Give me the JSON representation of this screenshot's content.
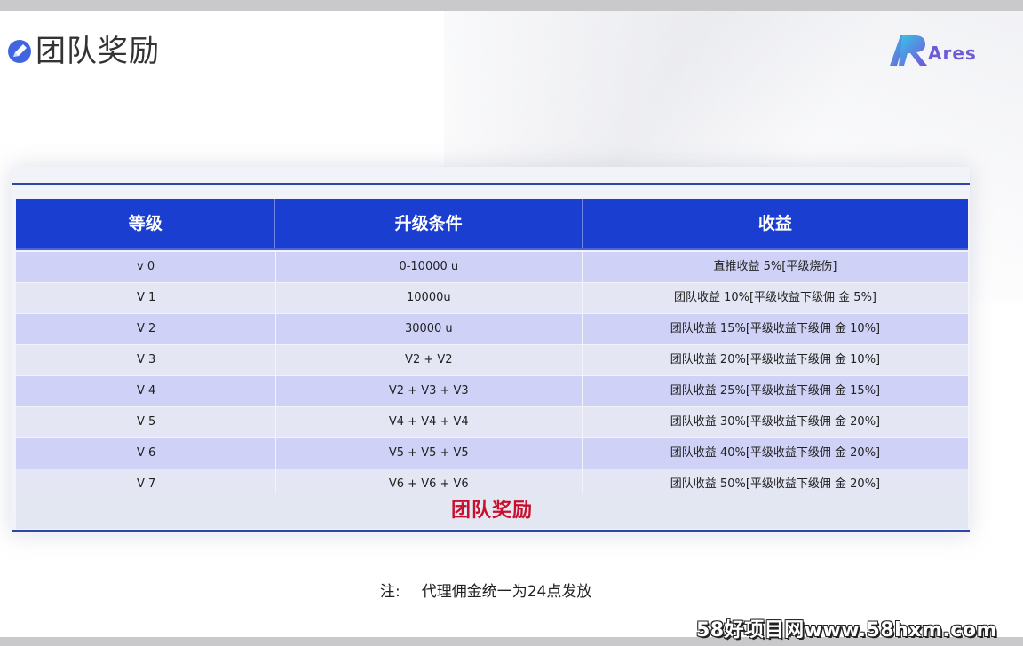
{
  "header": {
    "title": "团队奖励",
    "title_icon": "pencil-badge-icon",
    "logo_text": "Ares",
    "logo_icon": "ares-logo-icon"
  },
  "table": {
    "columns": [
      "等级",
      "升级条件",
      "收益"
    ],
    "rows": [
      {
        "level": "v 0",
        "condition": "0-10000 u",
        "reward": "直推收益 5%[平级烧伤]"
      },
      {
        "level": "V 1",
        "condition": "10000u",
        "reward": "团队收益 10%[平级收益下级佣 金 5%]"
      },
      {
        "level": "V 2",
        "condition": "30000 u",
        "reward": "团队收益 15%[平级收益下级佣 金 10%]"
      },
      {
        "level": "V 3",
        "condition": "V2 + V2",
        "reward": "团队收益 20%[平级收益下级佣 金 10%]"
      },
      {
        "level": "V 4",
        "condition": "V2 + V3 + V3",
        "reward": "团队收益 25%[平级收益下级佣 金 15%]"
      },
      {
        "level": "V 5",
        "condition": "V4 + V4 + V4",
        "reward": "团队收益 30%[平级收益下级佣 金 20%]"
      },
      {
        "level": "V 6",
        "condition": "V5 + V5 + V5",
        "reward": "团队收益 40%[平级收益下级佣 金 20%]"
      },
      {
        "level": "V 7",
        "condition": "V6 + V6 + V6",
        "reward": "团队收益 50%[平级收益下级佣 金 20%]"
      }
    ],
    "footer_title": "团队奖励"
  },
  "note": {
    "label": "注:",
    "text": "代理佣金统一为24点发放"
  },
  "watermark": "58好项目网www.58hxm.com",
  "colors": {
    "header_blue": "#1a3fd0",
    "row_odd": "#cfd2f6",
    "row_even": "#e4e6f4",
    "accent_red": "#c8102e",
    "logo_purple": "#6a5bd6"
  }
}
